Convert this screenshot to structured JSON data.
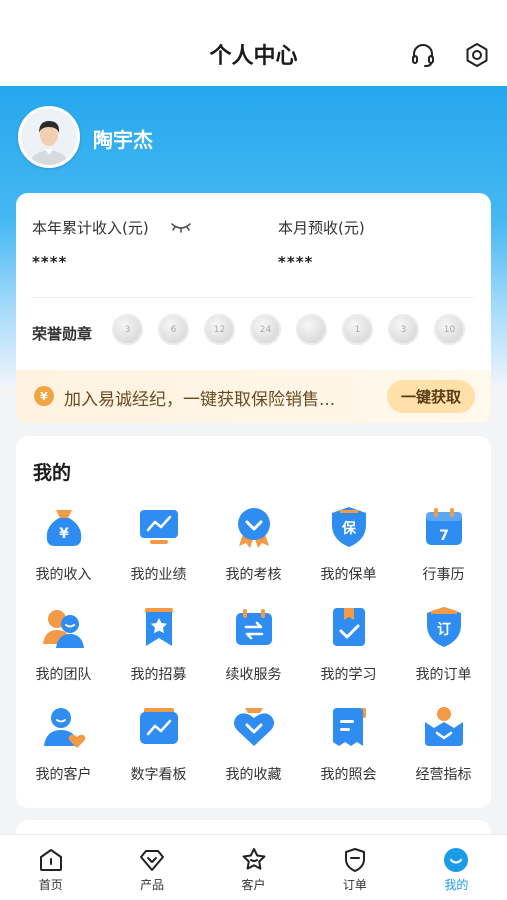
{
  "header": {
    "title": "个人中心",
    "headset_icon": "headset-icon",
    "settings_icon": "settings-icon"
  },
  "profile": {
    "name": "陶宇杰",
    "avatar_icon": "avatar-icon"
  },
  "income": {
    "year_label": "本年累计收入(元)",
    "year_value": "****",
    "month_label": "本月预收(元)",
    "month_value": "****",
    "eye_icon": "eye-closed-icon"
  },
  "honor": {
    "label": "荣誉勋章",
    "badges": [
      "3",
      "6",
      "12",
      "24",
      "",
      "1",
      "3",
      "10"
    ]
  },
  "join": {
    "text": "加入易诚经纪，一键获取保险销售...",
    "button": "一键获取",
    "icon": "coin-icon"
  },
  "mine": {
    "title": "我的",
    "items": [
      {
        "label": "我的收入",
        "icon": "money-bag-icon"
      },
      {
        "label": "我的业绩",
        "icon": "monitor-chart-icon"
      },
      {
        "label": "我的考核",
        "icon": "medal-icon"
      },
      {
        "label": "我的保单",
        "icon": "shield-policy-icon"
      },
      {
        "label": "行事历",
        "icon": "calendar-icon"
      },
      {
        "label": "我的团队",
        "icon": "team-icon"
      },
      {
        "label": "我的招募",
        "icon": "bookmark-star-icon"
      },
      {
        "label": "续收服务",
        "icon": "renewal-icon"
      },
      {
        "label": "我的学习",
        "icon": "study-icon"
      },
      {
        "label": "我的订单",
        "icon": "order-icon"
      },
      {
        "label": "我的客户",
        "icon": "customer-icon"
      },
      {
        "label": "数字看板",
        "icon": "dashboard-icon"
      },
      {
        "label": "我的收藏",
        "icon": "heart-icon"
      },
      {
        "label": "我的照会",
        "icon": "document-icon"
      },
      {
        "label": "经营指标",
        "icon": "crown-icon"
      }
    ]
  },
  "tabbar": {
    "items": [
      {
        "label": "首页",
        "icon": "home-icon"
      },
      {
        "label": "产品",
        "icon": "product-icon"
      },
      {
        "label": "客户",
        "icon": "customer-star-icon"
      },
      {
        "label": "订单",
        "icon": "order-shield-icon"
      },
      {
        "label": "我的",
        "icon": "smile-icon"
      }
    ],
    "active_color": "#1a9be6"
  },
  "colors": {
    "accent": "#1a9be6",
    "hero_top": "#26a7ee"
  }
}
